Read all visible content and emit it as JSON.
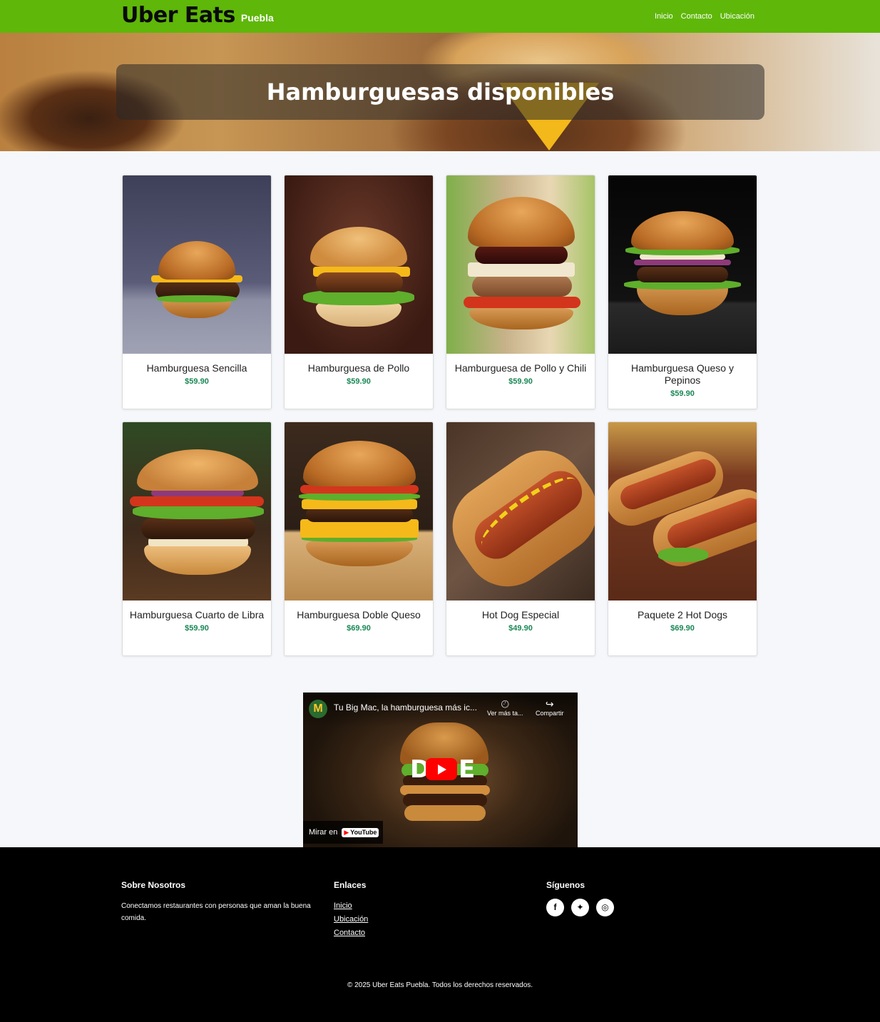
{
  "navbar": {
    "brand": "Uber Eats",
    "city": "Puebla",
    "links": [
      "Inicio",
      "Contacto",
      "Ubicación"
    ],
    "bg_color": "#5fb709"
  },
  "hero": {
    "title": "Hamburguesas disponibles"
  },
  "products": [
    {
      "name": "Hamburguesa Sencilla",
      "price": "$59.90"
    },
    {
      "name": "Hamburguesa de Pollo",
      "price": "$59.90"
    },
    {
      "name": "Hamburguesa de Pollo y Chili",
      "price": "$59.90"
    },
    {
      "name": "Hamburguesa Queso y Pepinos",
      "price": "$59.90"
    },
    {
      "name": "Hamburguesa Cuarto de Libra",
      "price": "$59.90"
    },
    {
      "name": "Hamburguesa Doble Queso",
      "price": "$69.90"
    },
    {
      "name": "Hot Dog Especial",
      "price": "$49.90"
    },
    {
      "name": "Paquete 2 Hot Dogs",
      "price": "$69.90"
    }
  ],
  "video": {
    "title": "Tu Big Mac, la hamburguesa más ic...",
    "watch_later": "Ver más ta...",
    "share": "Compartir",
    "watch_on": "Mirar en",
    "youtube": "YouTube",
    "overlay_left": "D",
    "overlay_right": "E"
  },
  "footer": {
    "about_title": "Sobre Nosotros",
    "about_text": "Conectamos restaurantes con personas que aman la buena comida.",
    "links_title": "Enlaces",
    "links": [
      "Inicio",
      "Ubicación",
      "Contacto"
    ],
    "social_title": "Síguenos",
    "social_icons": [
      "facebook-icon",
      "twitter-icon",
      "instagram-icon"
    ],
    "copyright": "© 2025 Uber Eats Puebla. Todos los derechos reservados."
  },
  "colors": {
    "price": "#198754",
    "footer_bg": "#000000"
  }
}
